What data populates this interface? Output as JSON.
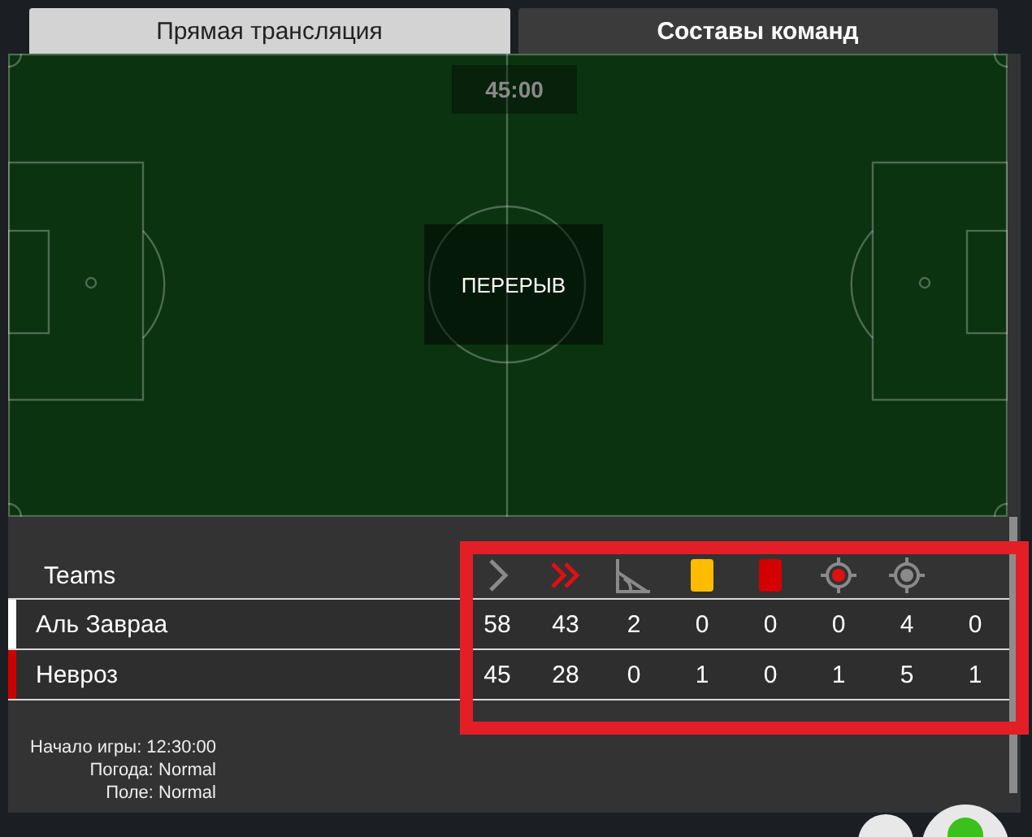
{
  "tabs": [
    {
      "label": "Прямая трансляция",
      "selected": true
    },
    {
      "label": "Составы команд",
      "selected": false
    }
  ],
  "match": {
    "clock": "45:00",
    "status": "ПЕРЕРЫВ"
  },
  "stats": {
    "header": "Teams",
    "highlighted": true,
    "columns": [
      {
        "kind": "attack"
      },
      {
        "kind": "dangerous-attack"
      },
      {
        "kind": "corner"
      },
      {
        "kind": "yellow-card"
      },
      {
        "kind": "red-card"
      },
      {
        "kind": "shot-on-target"
      },
      {
        "kind": "shot-off-target"
      },
      {
        "kind": "blank"
      }
    ],
    "teams": [
      {
        "name": "Аль Завраа",
        "color": "#ffffff",
        "values": [
          "58",
          "43",
          "2",
          "0",
          "0",
          "0",
          "4",
          "0"
        ]
      },
      {
        "name": "Невроз",
        "color": "#cc0000",
        "values": [
          "45",
          "28",
          "0",
          "1",
          "0",
          "1",
          "5",
          "1"
        ]
      }
    ]
  },
  "info": [
    "Начало игры: 12:30:00",
    "Погода: Normal",
    "Поле: Normal"
  ]
}
